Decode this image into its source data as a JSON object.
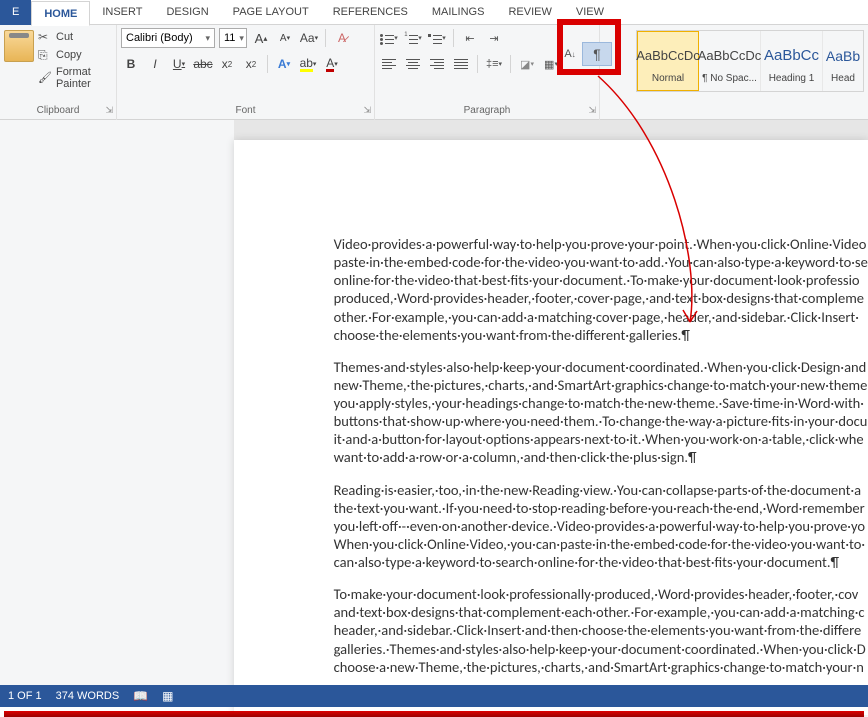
{
  "tabs": {
    "file": "E",
    "home": "HOME",
    "insert": "INSERT",
    "design": "DESIGN",
    "pagelayout": "PAGE LAYOUT",
    "references": "REFERENCES",
    "mailings": "MAILINGS",
    "review": "REVIEW",
    "view": "VIEW"
  },
  "clipboard": {
    "cut": "Cut",
    "copy": "Copy",
    "formatpainter": "Format Painter",
    "label": "Clipboard"
  },
  "font": {
    "name": "Calibri (Body)",
    "size": "11",
    "label": "Font"
  },
  "paragraph": {
    "label": "Paragraph",
    "pilcrow": "¶"
  },
  "styles": {
    "sample1": "AaBbCcDc",
    "sample2": "AaBbCcDc",
    "sample3": "AaBbCc",
    "sample4": "AaBb",
    "normal": "Normal",
    "nospacing": "¶ No Spac...",
    "heading1": "Heading 1",
    "heading2": "Head"
  },
  "document": {
    "p1": "Video·provides·a·powerful·way·to·help·you·prove·your·point.·When·you·click·Online·Video paste·in·the·embed·code·for·the·video·you·want·to·add.·You·can·also·type·a·keyword·to·se online·for·the·video·that·best·fits·your·document.·To·make·your·document·look·professio produced,·Word·provides·header,·footer,·cover·page,·and·text·box·designs·that·compleme other.·For·example,·you·can·add·a·matching·cover·page,·header,·and·sidebar.·Click·Insert· choose·the·elements·you·want·from·the·different·galleries.¶",
    "p2": "Themes·and·styles·also·help·keep·your·document·coordinated.·When·you·click·Design·and new·Theme,·the·pictures,·charts,·and·SmartArt·graphics·change·to·match·your·new·theme you·apply·styles,·your·headings·change·to·match·the·new·theme.·Save·time·in·Word·with· buttons·that·show·up·where·you·need·them.·To·change·the·way·a·picture·fits·in·your·docu it·and·a·button·for·layout·options·appears·next·to·it.·When·you·work·on·a·table,·click·whe want·to·add·a·row·or·a·column,·and·then·click·the·plus·sign.¶",
    "p3": "Reading·is·easier,·too,·in·the·new·Reading·view.·You·can·collapse·parts·of·the·document·a the·text·you·want.·If·you·need·to·stop·reading·before·you·reach·the·end,·Word·remember you·left·off·-·even·on·another·device.·Video·provides·a·powerful·way·to·help·you·prove·yo When·you·click·Online·Video,·you·can·paste·in·the·embed·code·for·the·video·you·want·to· can·also·type·a·keyword·to·search·online·for·the·video·that·best·fits·your·document.¶",
    "p4": "To·make·your·document·look·professionally·produced,·Word·provides·header,·footer,·cov and·text·box·designs·that·complement·each·other.·For·example,·you·can·add·a·matching·c header,·and·sidebar.·Click·Insert·and·then·choose·the·elements·you·want·from·the·differe galleries.·Themes·and·styles·also·help·keep·your·document·coordinated.·When·you·click·D choose·a·new·Theme,·the·pictures,·charts,·and·SmartArt·graphics·change·to·match·your·n"
  },
  "statusbar": {
    "page": "1 OF 1",
    "words": "374 WORDS"
  }
}
